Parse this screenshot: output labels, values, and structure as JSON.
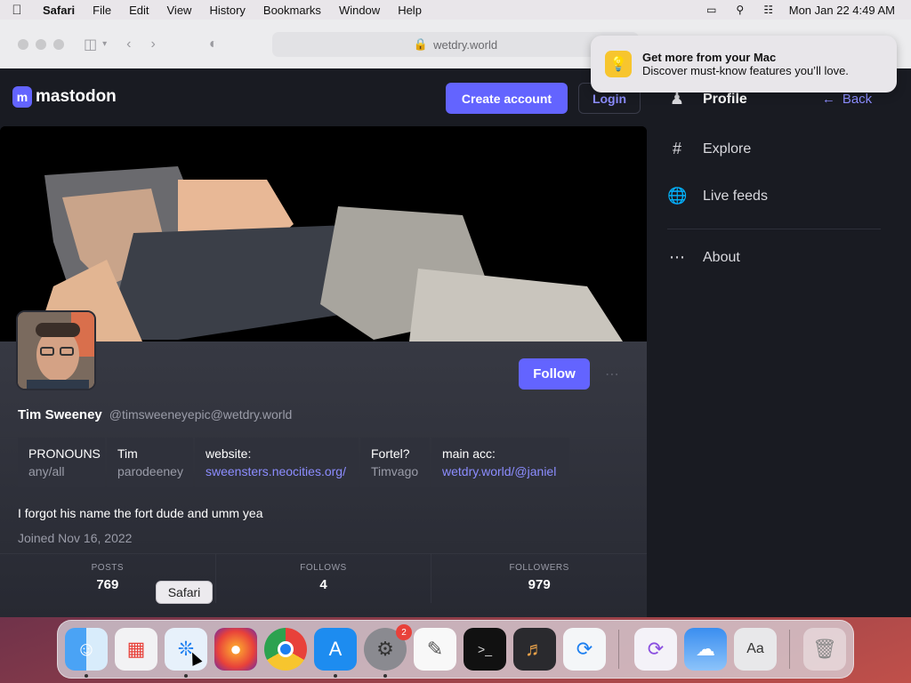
{
  "menubar": {
    "apple_icon": "apple-icon",
    "app_name": "Safari",
    "items": [
      "File",
      "Edit",
      "View",
      "History",
      "Bookmarks",
      "Window",
      "Help"
    ],
    "clock": "Mon Jan 22  4:49 AM"
  },
  "browser": {
    "url": "wetdry.world"
  },
  "notification": {
    "title": "Get more from your Mac",
    "body": "Discover must-know features you’ll love."
  },
  "mastodon": {
    "logo_text": "mastodon",
    "create_account": "Create account",
    "login": "Login",
    "back": "Back",
    "nav": [
      {
        "label": "Profile",
        "icon": "person-icon"
      },
      {
        "label": "Explore",
        "icon": "hash-icon"
      },
      {
        "label": "Live feeds",
        "icon": "globe-icon"
      },
      {
        "label": "About",
        "icon": "ellipsis-icon"
      }
    ]
  },
  "profile": {
    "display_name": "Tim Sweeney",
    "handle": "@timsweeneyepic@wetdry.world",
    "follow": "Follow",
    "fields": [
      {
        "key": "PRONOUNS",
        "value": "any/all",
        "link": false
      },
      {
        "key": "Tim",
        "value": "parodeeney",
        "link": false
      },
      {
        "key": "website:",
        "value": "sweensters.neocities.org/",
        "link": true
      },
      {
        "key": "Fortel?",
        "value": "Timvago",
        "link": false
      },
      {
        "key": "main acc:",
        "value": "wetdry.world/@janiel",
        "link": true
      }
    ],
    "bio": "I forgot his name the fort dude and umm yea",
    "joined": "Joined Nov 16, 2022",
    "stats": {
      "posts_label": "POSTS",
      "posts": "769",
      "follows_label": "FOLLOWS",
      "follows": "4",
      "followers_label": "FOLLOWERS",
      "followers": "979"
    }
  },
  "dock": {
    "tooltip": "Safari",
    "settings_badge": "2",
    "apps": [
      "Finder",
      "Launchpad",
      "Safari",
      "Firefox",
      "Chrome",
      "App Store",
      "System Settings",
      "TextEdit",
      "Terminal",
      "GarageBand",
      "VS Code",
      "Visual Studio",
      "Weather",
      "Font Book",
      "Trash"
    ]
  },
  "colors": {
    "accent": "#6364ff",
    "link": "#8c8dff",
    "background": "#191b22"
  }
}
